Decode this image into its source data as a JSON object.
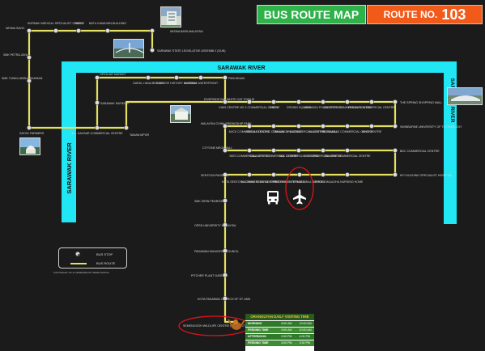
{
  "header": {
    "title": "BUS ROUTE MAP",
    "route_label": "ROUTE NO.",
    "route_number": "103"
  },
  "rivers": {
    "top": "SARAWAK RIVER",
    "left": "SARAWAK RIVER",
    "right": "SARAWAK RIVER"
  },
  "colors": {
    "route": "#e4e060",
    "river": "#21e7f4",
    "stop_fill": "#dedede",
    "title_green": "#2fb24a",
    "title_orange": "#f25a1a",
    "annotation": "#d8161b",
    "panel_header": "#2b5a21",
    "panel_row": "#2f7a2a"
  },
  "stops": {
    "s1": "NORMAH MEDICAL SPECIALIST CENTRE",
    "s2": "DBKU",
    "s3": "BATU KAWA MIN BUILDING",
    "s4": "WISMA BAPA MALAYSIA",
    "s5": "SARAWAK STATE LEGISLATIVE ASSEMBLY (DUN)",
    "s6": "WISMA SAVIC",
    "s7": "SMK PETRA JAYA",
    "s8": "SMK TUNKU ABDUL RAHMAN",
    "s9": "SATOK FARMERS",
    "s10": "OPEN AIR MARKET",
    "s11": "SARAWAK MUSEUM",
    "s12": "DARUL HANA BRIDGE",
    "s13": "CHINESE HISTORY MUSEUM",
    "s14": "KUCHING WATERFRONT",
    "s15": "PADUNGAN",
    "s16": "AL - KAUSAR COMMERCIAL CENTRE",
    "s17": "TAMAN MPOR",
    "s18": "RIVERSIDE BAT WHITE CAT STATUE",
    "s19": "KING CENTRE NO 2 COMMERCIAL CENTRE",
    "s20": "DBKU",
    "s21": "CROWN SQUARE",
    "s22": "KENANGA POLICE STATION",
    "s23": "MAJESTIC COMMERCIAL CENTRE",
    "s24": "PANOVEL COMMERCIAL CENTRE",
    "s25": "THE SPRING SHOPPING MALL",
    "s26": "SWINBURNE UNIVERSITY OF TECHNOLOGY",
    "s27": "MALAYSIA CHINA FRIENDSHIP PARK",
    "s28": "MJCK COMMERCIAL CENTRE",
    "s29": "SIBIDU STUTONG COMMUNITY MARKET",
    "s30": "TABUAN JAYA COMMERCIAL CENTRE",
    "s31": "VIVACITY MEGAMALL",
    "s32": "FLORADALE COMMERCIAL CENTRE",
    "s33": "KING CENTRE",
    "s34": "CITYONE MEGAMALL",
    "s35": "MDS COMMERCIAL CENTRE",
    "s36": "GALA CITY COMMERCIAL CENTRE",
    "s37": "BDC COMMERCIAL CENTRE",
    "s38": "RH COMMERCIAL CENTRE",
    "s39": "SAMARIE COMMERCIAL CENTRE",
    "s40": "BDC COMMERCIAL CENTRE",
    "s41": "SENTOSA PASSION",
    "s42": "KOTA SENTOSA COMMERCIAL CENTRE",
    "s43": "KUCHING SENTRAL EXPRESS BUS TERMINAL",
    "s44": "KUCHING INTERNATIONAL AIRPORT",
    "s45": "SEMOLA MALL",
    "s46": "LOHA NURSING HOME",
    "s47": "KPJ KUCHING SPECIALIST HOSPITAL",
    "s48": "SMK SIRIN PENRISSEN",
    "s49": "OPEN UNIVERSITY MALAYSIA",
    "s50": "PADAWAN MUNICIPAL COUNCIL",
    "s51": "PITCHER PLANT GARDEN",
    "s52": "KOTA PADAWAN CHURCH OF ST. ANN",
    "s53": "SEMENGGOH WILDLIFE CENTRE (ORANGUTAN)"
  },
  "legend": {
    "stop_label": "BUS STOP",
    "route_label": "BUS ROUTE"
  },
  "copyright": "COPYRIGHT OF & OPERATED BY RESE PACIFIC",
  "orangutan_panel": {
    "title": "ORANGUTAN DAILY VISITING TIME",
    "rows": [
      {
        "label": "MORNING",
        "start": "8:00 AM",
        "end": "10:00 AM"
      },
      {
        "label": "FEEDING TIME",
        "start": "9:00 AM",
        "end": "10:00 AM"
      },
      {
        "label": "AFTERNOON",
        "start": "2:00 PM",
        "end": "4:00 PM"
      },
      {
        "label": "FEEDING TIME",
        "start": "3:00 PM",
        "end": "3:30 PM"
      }
    ],
    "separator": "-"
  },
  "icons": [
    "bus-icon",
    "airplane-icon",
    "orangutan-icon",
    "building-photo",
    "bridge-photo",
    "mosque-photo",
    "shopping-mall-photo",
    "museum-photo"
  ]
}
